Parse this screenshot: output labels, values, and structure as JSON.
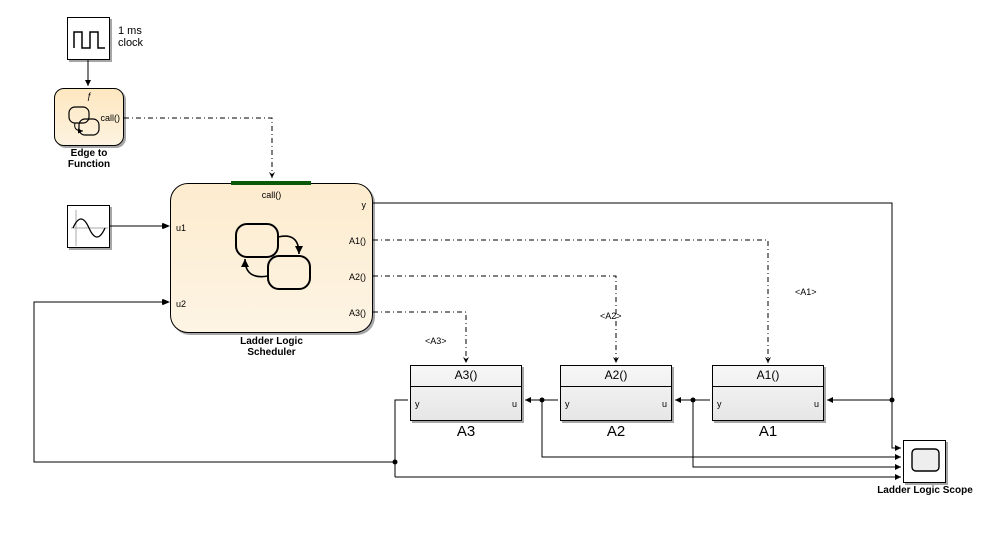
{
  "clock": {
    "label": "1 ms\nclock"
  },
  "edgeToFunction": {
    "label": "Edge to\nFunction",
    "out": "call()",
    "topGlyph": "ƒ"
  },
  "sineBlock": {},
  "scheduler": {
    "label": "Ladder Logic\nScheduler",
    "in": {
      "call": "call()",
      "u1": "u1",
      "u2": "u2"
    },
    "out": {
      "y": "y",
      "A1": "A1()",
      "A2": "A2()",
      "A3": "A3()"
    }
  },
  "tags": {
    "A1": "<A1>",
    "A2": "<A2>",
    "A3": "<A3>"
  },
  "fcn": {
    "A1": {
      "title": "A1()",
      "name": "A1",
      "in": "u",
      "out": "y"
    },
    "A2": {
      "title": "A2()",
      "name": "A2",
      "in": "u",
      "out": "y"
    },
    "A3": {
      "title": "A3()",
      "name": "A3",
      "in": "u",
      "out": "y"
    }
  },
  "scope": {
    "label": "Ladder Logic Scope"
  }
}
